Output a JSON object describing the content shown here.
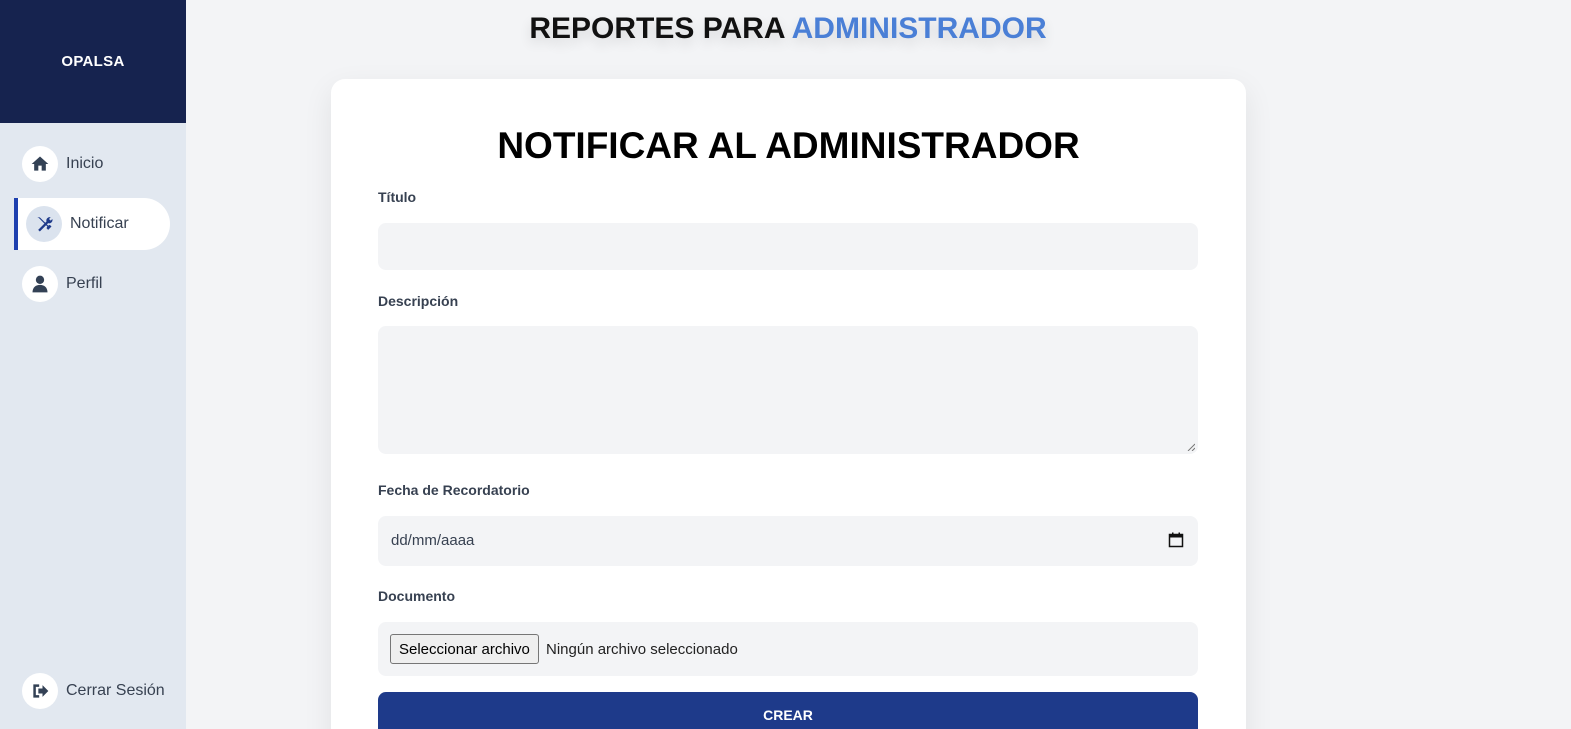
{
  "brand": "OPALSA",
  "nav": {
    "items": [
      {
        "label": "Inicio",
        "icon": "home-icon"
      },
      {
        "label": "Notificar",
        "icon": "tools-icon",
        "active": true
      },
      {
        "label": "Perfil",
        "icon": "user-icon"
      }
    ],
    "logout": {
      "label": "Cerrar Sesión",
      "icon": "logout-icon"
    }
  },
  "header": {
    "title_prefix": "REPORTES PARA ",
    "title_accent": "ADMINISTRADOR"
  },
  "form": {
    "title": "NOTIFICAR AL ADMINISTRADOR",
    "titulo_label": "Título",
    "descripcion_label": "Descripción",
    "fecha_label": "Fecha de Recordatorio",
    "fecha_placeholder": "dd/mm/aaaa",
    "documento_label": "Documento",
    "file_button": "Seleccionar archivo",
    "file_status": "Ningún archivo seleccionado",
    "submit": "CREAR"
  },
  "colors": {
    "brand_bg": "#16234f",
    "accent": "#4a7fd6",
    "primary_button": "#1e3a8a",
    "active_indicator": "#1e40af"
  }
}
